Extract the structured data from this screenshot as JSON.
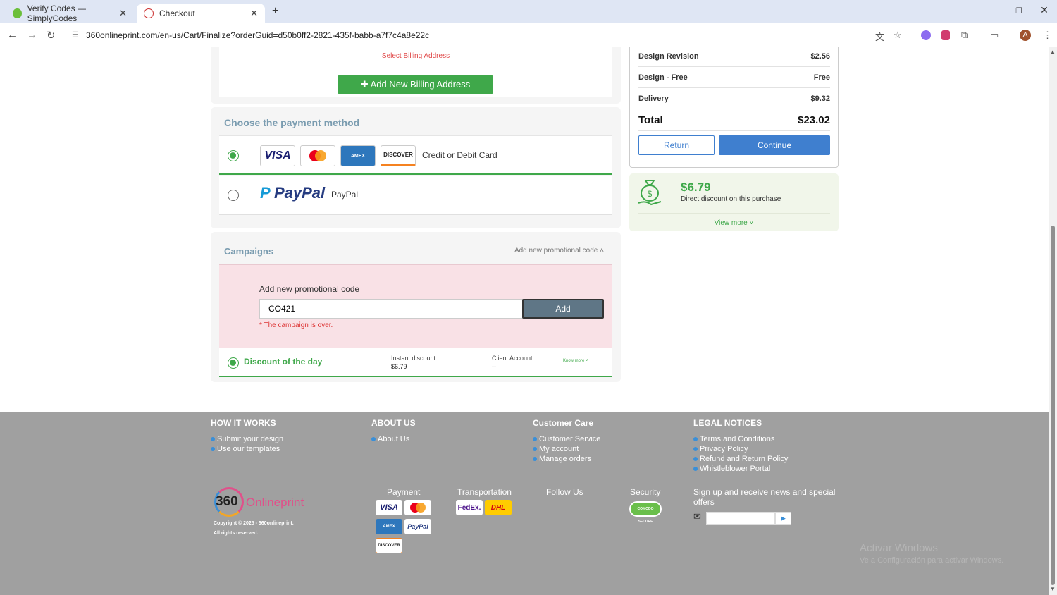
{
  "browser": {
    "tabs": [
      {
        "label": "Verify Codes — SimplyCodes"
      },
      {
        "label": "Checkout"
      }
    ],
    "url": "360onlineprint.com/en-us/Cart/Finalize?orderGuid=d50b0ff2-2821-435f-babb-a7f7c4a8e22c"
  },
  "billing": {
    "select_label": "Select Billing Address",
    "add_button": "Add New Billing Address"
  },
  "payment": {
    "title": "Choose the payment method",
    "card_logos": [
      "VISA",
      "MC",
      "AMEX",
      "DISCOVER"
    ],
    "card_label": "Credit or Debit Card",
    "paypal_logo": "PayPal",
    "paypal_label": "PayPal",
    "selected": "card"
  },
  "campaigns": {
    "title": "Campaigns",
    "toggle_label": "Add new promotional code",
    "promo_label": "Add new promotional code",
    "promo_value": "CO421",
    "add_button": "Add",
    "error": "* The campaign is over.",
    "discount_title": "Discount of the day",
    "instant_label": "Instant discount",
    "instant_value": "$6.79",
    "client_label": "Client Account",
    "client_value": "--",
    "know_more": "Know more"
  },
  "summary": {
    "rows": [
      {
        "label": "Design Revision",
        "value": "$2.56"
      },
      {
        "label": "Design - Free",
        "value": "Free"
      },
      {
        "label": "Delivery",
        "value": "$9.32"
      }
    ],
    "total_label": "Total",
    "total_value": "$23.02",
    "return_button": "Return",
    "continue_button": "Continue"
  },
  "discount_box": {
    "amount": "$6.79",
    "text": "Direct discount on this purchase",
    "view_more": "View more"
  },
  "footer": {
    "how": {
      "title": "HOW IT WORKS",
      "links": [
        "Submit your design",
        "Use our templates"
      ]
    },
    "about": {
      "title": "ABOUT US",
      "links": [
        "About Us"
      ]
    },
    "care": {
      "title": "Customer Care",
      "links": [
        "Customer Service",
        "My account",
        "Manage orders"
      ]
    },
    "legal": {
      "title": "LEGAL NOTICES",
      "links": [
        "Terms and Conditions",
        "Privacy Policy",
        "Refund and Return Policy",
        "Whistleblower Portal"
      ]
    },
    "logo_num": "360",
    "logo_text": "Onlineprint",
    "copyright": "Copyright © 2025 - 360onlineprint.",
    "rights": "All rights reserved.",
    "payment_title": "Payment",
    "transport_title": "Transportation",
    "follow_title": "Follow Us",
    "security_title": "Security",
    "security_badge": "COMODO SECURE",
    "newsletter_text": "Sign up and receive news and special offers",
    "pay_logos": [
      "VISA",
      "MC",
      "AMEX",
      "PayPal",
      "DISCOVER"
    ],
    "transport_logos": [
      "FedEx.",
      "DHL"
    ]
  },
  "watermark": {
    "line1": "Activar Windows",
    "line2": "Ve a Configuración para activar Windows."
  }
}
